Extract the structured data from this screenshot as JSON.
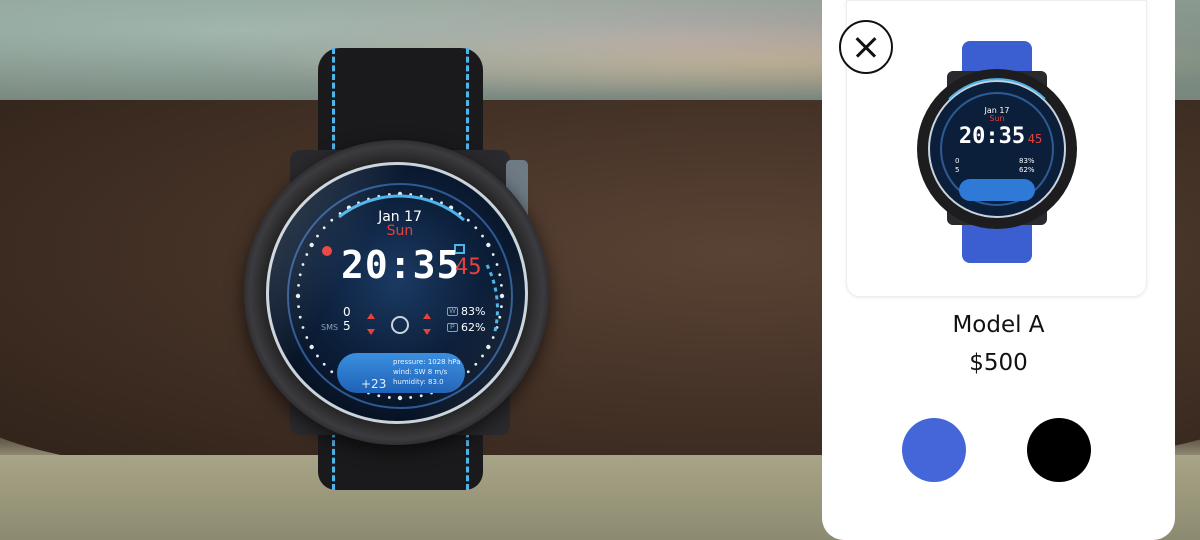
{
  "watch_face": {
    "date": "Jan 17",
    "day": "Sun",
    "time": "20:35",
    "seconds": "45",
    "calls": "0",
    "sms_label": "SMS",
    "sms": "5",
    "w_label": "W",
    "w_percent": "83%",
    "p_label": "P",
    "p_percent": "62%",
    "temperature": "+23",
    "pressure": "pressure: 1028 hPa",
    "wind": "wind: SW 8 m/s",
    "humidity": "humidity: 83.0"
  },
  "product": {
    "close_icon": "close-icon",
    "model_name": "Model A",
    "price": "$500",
    "colors": [
      {
        "name": "blue",
        "hex": "#4466d8"
      },
      {
        "name": "black",
        "hex": "#000000"
      }
    ]
  },
  "colors": {
    "accent_blue": "#4fb4ea",
    "accent_red": "#e8413c"
  }
}
